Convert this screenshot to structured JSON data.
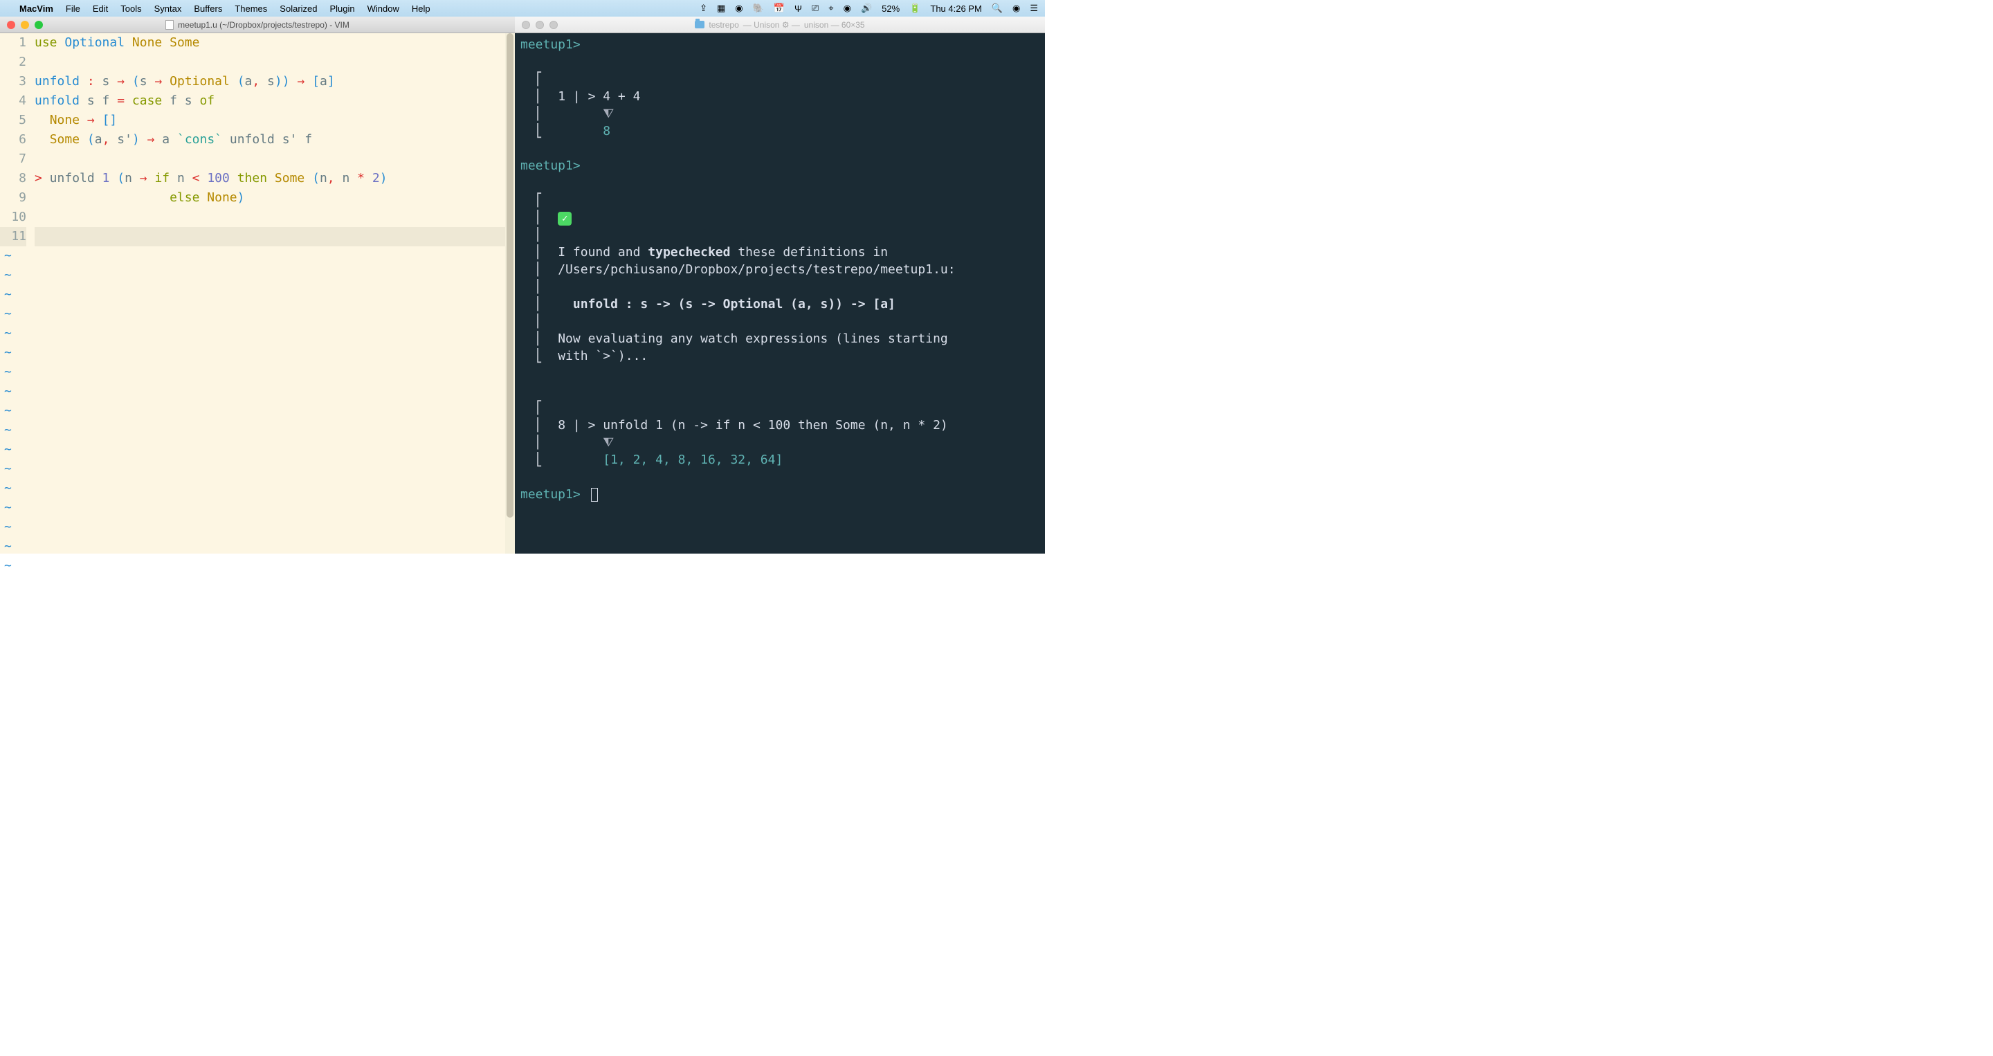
{
  "menubar": {
    "app_name": "MacVim",
    "items": [
      "File",
      "Edit",
      "Tools",
      "Syntax",
      "Buffers",
      "Themes",
      "Solarized",
      "Plugin",
      "Window",
      "Help"
    ],
    "battery_pct": "52%",
    "datetime": "Thu 4:26 PM"
  },
  "macvim": {
    "title": "meetup1.u (~/Dropbox/projects/testrepo) - VIM",
    "lines": [
      {
        "n": "1",
        "tokens": [
          {
            "c": "tok-keyword",
            "t": "use"
          },
          {
            "c": "",
            "t": " "
          },
          {
            "c": "tok-type",
            "t": "Optional"
          },
          {
            "c": "",
            "t": " "
          },
          {
            "c": "tok-constructor",
            "t": "None"
          },
          {
            "c": "",
            "t": " "
          },
          {
            "c": "tok-constructor",
            "t": "Some"
          }
        ]
      },
      {
        "n": "2",
        "tokens": []
      },
      {
        "n": "3",
        "tokens": [
          {
            "c": "tok-func",
            "t": "unfold"
          },
          {
            "c": "",
            "t": " "
          },
          {
            "c": "tok-operator",
            "t": ":"
          },
          {
            "c": "",
            "t": " s "
          },
          {
            "c": "tok-operator",
            "t": "→"
          },
          {
            "c": "",
            "t": " "
          },
          {
            "c": "tok-bracket",
            "t": "("
          },
          {
            "c": "",
            "t": "s "
          },
          {
            "c": "tok-operator",
            "t": "→"
          },
          {
            "c": "",
            "t": " "
          },
          {
            "c": "tok-constructor",
            "t": "Optional"
          },
          {
            "c": "",
            "t": " "
          },
          {
            "c": "tok-bracket",
            "t": "("
          },
          {
            "c": "",
            "t": "a"
          },
          {
            "c": "tok-operator",
            "t": ","
          },
          {
            "c": "",
            "t": " s"
          },
          {
            "c": "tok-bracket",
            "t": "))"
          },
          {
            "c": "",
            "t": " "
          },
          {
            "c": "tok-operator",
            "t": "→"
          },
          {
            "c": "",
            "t": " "
          },
          {
            "c": "tok-bracket",
            "t": "["
          },
          {
            "c": "",
            "t": "a"
          },
          {
            "c": "tok-bracket",
            "t": "]"
          }
        ]
      },
      {
        "n": "4",
        "tokens": [
          {
            "c": "tok-func",
            "t": "unfold"
          },
          {
            "c": "",
            "t": " s f "
          },
          {
            "c": "tok-operator",
            "t": "="
          },
          {
            "c": "",
            "t": " "
          },
          {
            "c": "tok-keyword",
            "t": "case"
          },
          {
            "c": "",
            "t": " f s "
          },
          {
            "c": "tok-keyword",
            "t": "of"
          }
        ]
      },
      {
        "n": "5",
        "tokens": [
          {
            "c": "",
            "t": "  "
          },
          {
            "c": "tok-constructor",
            "t": "None"
          },
          {
            "c": "",
            "t": " "
          },
          {
            "c": "tok-operator",
            "t": "→"
          },
          {
            "c": "",
            "t": " "
          },
          {
            "c": "tok-bracket",
            "t": "[]"
          }
        ]
      },
      {
        "n": "6",
        "tokens": [
          {
            "c": "",
            "t": "  "
          },
          {
            "c": "tok-constructor",
            "t": "Some"
          },
          {
            "c": "",
            "t": " "
          },
          {
            "c": "tok-bracket",
            "t": "("
          },
          {
            "c": "",
            "t": "a"
          },
          {
            "c": "tok-operator",
            "t": ","
          },
          {
            "c": "",
            "t": " s'"
          },
          {
            "c": "tok-bracket",
            "t": ")"
          },
          {
            "c": "",
            "t": " "
          },
          {
            "c": "tok-operator",
            "t": "→"
          },
          {
            "c": "",
            "t": " a "
          },
          {
            "c": "tok-string",
            "t": "`cons`"
          },
          {
            "c": "",
            "t": " unfold s' f"
          }
        ]
      },
      {
        "n": "7",
        "tokens": []
      },
      {
        "n": "8",
        "tokens": [
          {
            "c": "tok-operator",
            "t": ">"
          },
          {
            "c": "",
            "t": " unfold "
          },
          {
            "c": "tok-number",
            "t": "1"
          },
          {
            "c": "",
            "t": " "
          },
          {
            "c": "tok-bracket",
            "t": "("
          },
          {
            "c": "",
            "t": "n "
          },
          {
            "c": "tok-operator",
            "t": "→"
          },
          {
            "c": "",
            "t": " "
          },
          {
            "c": "tok-keyword",
            "t": "if"
          },
          {
            "c": "",
            "t": " n "
          },
          {
            "c": "tok-operator",
            "t": "<"
          },
          {
            "c": "",
            "t": " "
          },
          {
            "c": "tok-number",
            "t": "100"
          },
          {
            "c": "",
            "t": " "
          },
          {
            "c": "tok-keyword",
            "t": "then"
          },
          {
            "c": "",
            "t": " "
          },
          {
            "c": "tok-constructor",
            "t": "Some"
          },
          {
            "c": "",
            "t": " "
          },
          {
            "c": "tok-bracket",
            "t": "("
          },
          {
            "c": "",
            "t": "n"
          },
          {
            "c": "tok-operator",
            "t": ","
          },
          {
            "c": "",
            "t": " n "
          },
          {
            "c": "tok-operator",
            "t": "*"
          },
          {
            "c": "",
            "t": " "
          },
          {
            "c": "tok-number",
            "t": "2"
          },
          {
            "c": "tok-bracket",
            "t": ")"
          }
        ]
      },
      {
        "n": "9",
        "tokens": [
          {
            "c": "",
            "t": "                  "
          },
          {
            "c": "tok-keyword",
            "t": "else"
          },
          {
            "c": "",
            "t": " "
          },
          {
            "c": "tok-constructor",
            "t": "None"
          },
          {
            "c": "tok-bracket",
            "t": ")"
          }
        ]
      },
      {
        "n": "10",
        "tokens": []
      },
      {
        "n": "11",
        "tokens": [],
        "cursor": true
      }
    ],
    "tilde_count": 17
  },
  "terminal": {
    "title_left": "testrepo",
    "title_mid": "— Unison ⚙ —",
    "title_right": "unison — 60×35",
    "prompt": "meetup1>",
    "block1": {
      "ln": "1 | > 4 + 4",
      "arrow": "⧨",
      "result": "8"
    },
    "check": "✓",
    "msg1a": "I found and ",
    "msg1b": "typechecked",
    "msg1c": " these definitions in",
    "path": "/Users/pchiusano/Dropbox/projects/testrepo/meetup1.u:",
    "sig": "unfold : s -> (s -> Optional (a, s)) -> [a]",
    "msg2a": "Now evaluating any watch expressions (lines starting",
    "msg2b": "with `>`)...",
    "block2": {
      "ln": "8 | > unfold 1 (n -> if n < 100 then Some (n, n * 2)",
      "arrow": "⧨",
      "result": "[1, 2, 4, 8, 16, 32, 64]"
    }
  }
}
